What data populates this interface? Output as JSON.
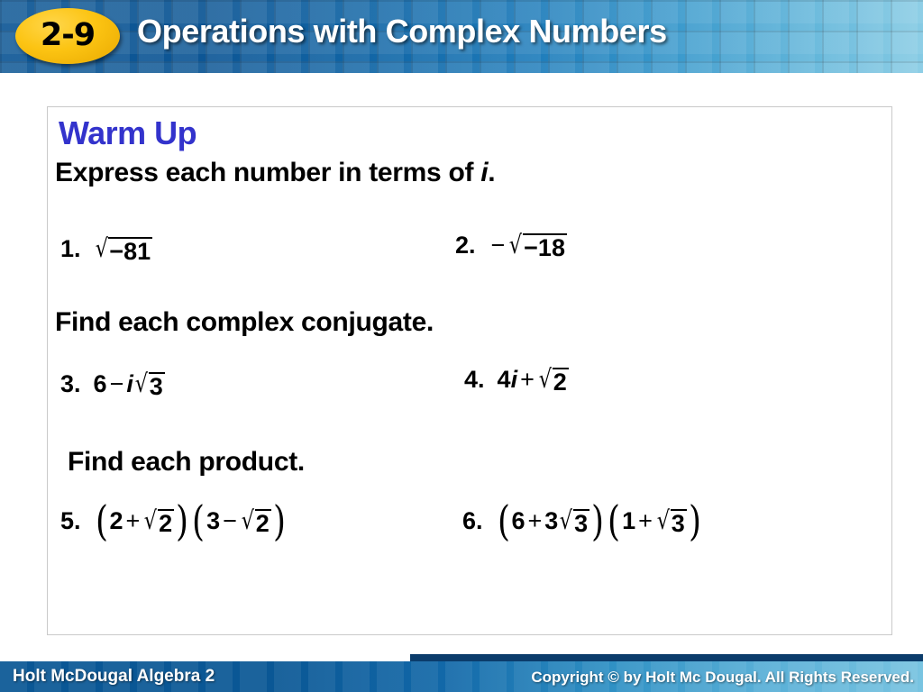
{
  "header": {
    "badge_label": "2-9",
    "title": "Operations with Complex Numbers",
    "bg_start_color": "#0d5695",
    "bg_end_color": "#86cbe4",
    "badge_color": "#fcc413",
    "title_color": "#ffffff"
  },
  "content": {
    "warm_up_label": "Warm Up",
    "warm_up_color": "#3333cc",
    "sections": [
      {
        "heading_pre": "Express each number in terms of ",
        "heading_italic": "i",
        "heading_post": "."
      },
      {
        "heading_pre": "Find each complex conjugate.",
        "heading_italic": "",
        "heading_post": ""
      },
      {
        "heading_pre": "Find each product.",
        "heading_italic": "",
        "heading_post": ""
      }
    ],
    "problems": [
      {
        "number": "1.",
        "expression": "√(−81)"
      },
      {
        "number": "2.",
        "expression": "−√(−18)"
      },
      {
        "number": "3.",
        "expression": "6 − i√3"
      },
      {
        "number": "4.",
        "expression": "4i + √2"
      },
      {
        "number": "5.",
        "expression": "(2 + √2)(3 − √2)"
      },
      {
        "number": "6.",
        "expression": "(6 + 3√3)(1 + √3)"
      }
    ],
    "parts": {
      "p1": {
        "radicand": "−81"
      },
      "p2": {
        "lead_minus": "−",
        "radicand": "−18"
      },
      "p3": {
        "a": "6",
        "op": "−",
        "i": "i",
        "radicand": "3"
      },
      "p4": {
        "a": "4",
        "i": "i",
        "op": "+",
        "radicand": "2"
      },
      "p5": {
        "open1": "(",
        "a1": "2",
        "op1": "+",
        "rad1": "2",
        "close1": ")",
        "open2": "(",
        "a2": "3",
        "op2": "−",
        "rad2": "2",
        "close2": ")"
      },
      "p6": {
        "open1": "(",
        "a1": "6",
        "op1": "+",
        "coef1": "3",
        "rad1": "3",
        "close1": ")",
        "open2": "(",
        "a2": "1",
        "op2": "+",
        "rad2": "3",
        "close2": ")"
      }
    }
  },
  "footer": {
    "left_text": "Holt McDougal Algebra 2",
    "right_text": "Copyright © by Holt Mc Dougal. All Rights Reserved.",
    "bg_start_color": "#0a5795",
    "bg_end_color": "#79c4e1"
  }
}
